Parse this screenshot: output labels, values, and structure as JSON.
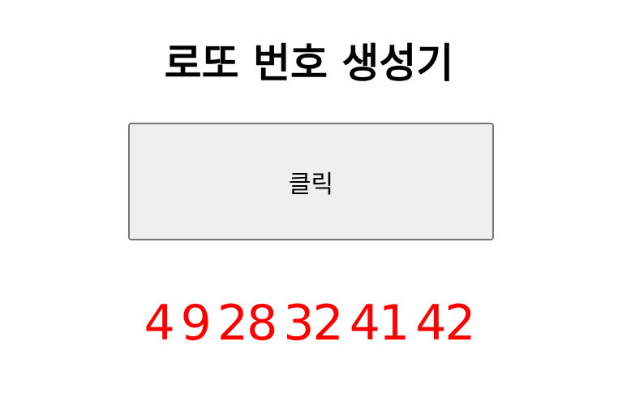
{
  "app": {
    "title": "로또 번호 생성기"
  },
  "controls": {
    "generate_label": "클릭"
  },
  "result": {
    "numbers_text": "4 9 28 32 41 42",
    "color": "#ff0000"
  }
}
